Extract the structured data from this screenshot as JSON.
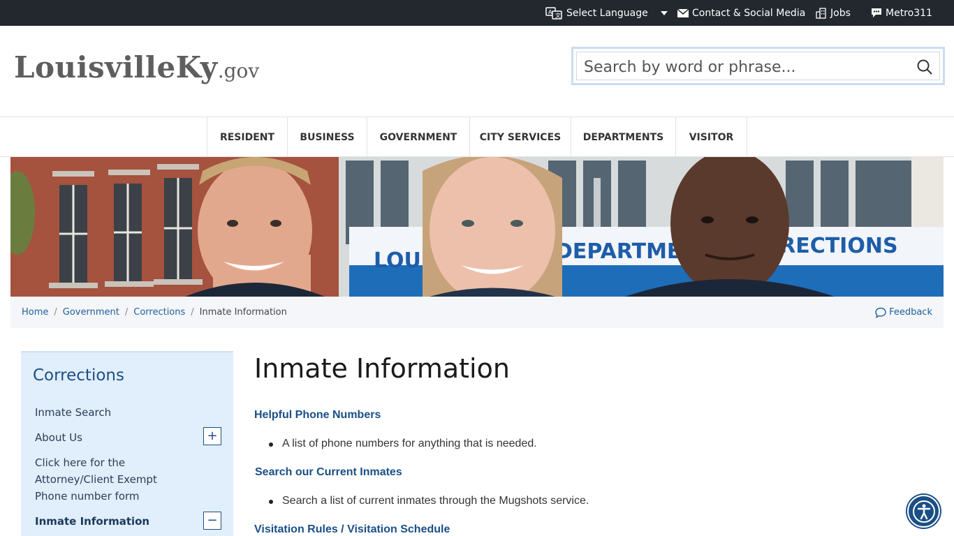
{
  "topbar": {
    "language_label": "Select Language",
    "contact_label": "Contact & Social Media",
    "jobs_label": "Jobs",
    "metro_label": "Metro311"
  },
  "header": {
    "logo_main": "LouisvilleKy",
    "logo_tld": ".gov",
    "search_placeholder": "Search by word or phrase..."
  },
  "nav": {
    "items": [
      {
        "label": "RESIDENT"
      },
      {
        "label": "BUSINESS"
      },
      {
        "label": "GOVERNMENT"
      },
      {
        "label": "CITY SERVICES"
      },
      {
        "label": "DEPARTMENTS"
      },
      {
        "label": "VISITOR"
      }
    ]
  },
  "hero": {
    "sign_left": "LOUIS",
    "sign_mid": "DEPARTMEN",
    "sign_right": "RRECTIONS"
  },
  "breadcrumb": {
    "items": [
      "Home",
      "Government",
      "Corrections"
    ],
    "current": "Inmate Information",
    "feedback_label": "Feedback"
  },
  "sidebar": {
    "title": "Corrections",
    "items": [
      {
        "label": "Inmate Search"
      },
      {
        "label": "About Us",
        "toggle": "+"
      },
      {
        "line1": "Click here for the",
        "line2": "Attorney/Client Exempt",
        "line3": "Phone number form"
      },
      {
        "label": "Inmate Information",
        "toggle": "−"
      }
    ]
  },
  "content": {
    "title": "Inmate Information",
    "sections": [
      {
        "link": "Helpful Phone Numbers",
        "bullet": "A list of phone numbers for anything that is needed."
      },
      {
        "link": "Search our Current Inmates",
        "bullet": "Search a list of current inmates through the Mugshots service."
      },
      {
        "link": "Visitation Rules / Visitation Schedule"
      }
    ]
  },
  "colors": {
    "topbar_bg": "#23272e",
    "link_blue": "#1a4f87",
    "sidebar_bg": "#e1eefb",
    "accessibility_btn": "#1a4f86"
  }
}
